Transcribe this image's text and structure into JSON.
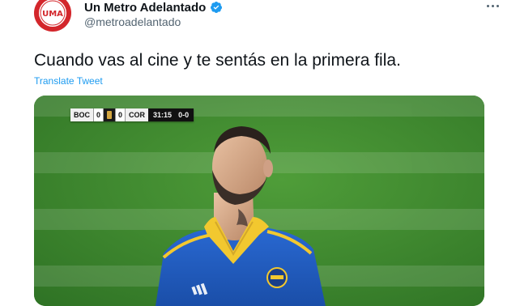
{
  "tweet": {
    "display_name": "Un Metro Adelantado",
    "handle": "@metroadelantado",
    "text": "Cuando vas al cine y te sentás en la primera fila.",
    "translate_label": "Translate Tweet",
    "avatar_initials": "UMA",
    "verified_icon": "verified-badge-icon",
    "more_icon": "more-options-icon"
  },
  "scoreboard": {
    "home_team": "BOC",
    "home_score": "0",
    "away_score": "0",
    "away_team": "COR",
    "clock": "31:15",
    "aggregate": "0-0"
  },
  "colors": {
    "link": "#1d9bf0",
    "handle": "#536471",
    "pitch": "#3f8a2e",
    "jersey": "#1f5cc4",
    "collar": "#f2c82f",
    "avatar": "#d3262b"
  }
}
